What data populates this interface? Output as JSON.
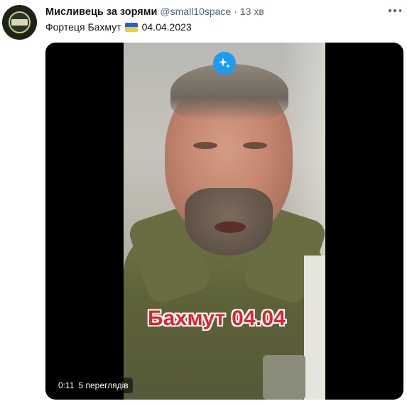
{
  "tweet": {
    "author_name": "Мисливець за зорями",
    "handle": "@small10space",
    "separator": "·",
    "time": "13 хв",
    "text_before_flag": "Фортеця Бахмут",
    "text_after_flag": "04.04.2023"
  },
  "icons": {
    "more": "more-horizontal-icon",
    "flag": "ukraine-flag-icon",
    "sparkle": "sparkle-icon"
  },
  "media": {
    "overlay_caption": "Бахмут 04.04",
    "duration": "0:11",
    "views": "5 переглядів"
  },
  "colors": {
    "accent": "#1d9bf0",
    "caption_red": "#e8202a"
  }
}
